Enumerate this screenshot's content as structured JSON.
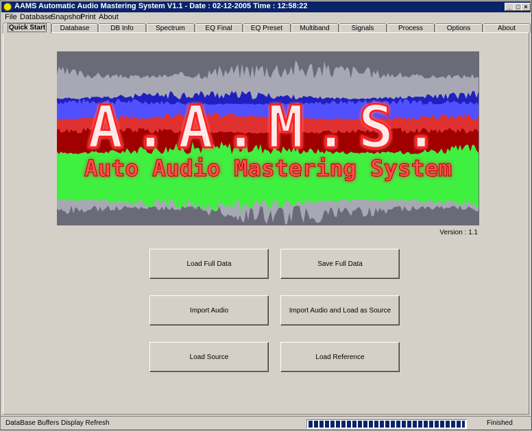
{
  "window": {
    "title": "AAMS Automatic Audio Mastering System V1.1  -  Date :  02-12-2005   Time : 12:58:22"
  },
  "menu": [
    "File",
    "Database",
    "Snapshot",
    "Print",
    "About"
  ],
  "tabs": [
    "Quick Start",
    "Database",
    "DB Info",
    "Spectrum",
    "EQ Final",
    "EQ Preset",
    "Multiband",
    "Signals",
    "Process",
    "Options",
    "About"
  ],
  "active_tab": "Quick Start",
  "banner": {
    "logo_text": "A.A.M.S.",
    "logo_subtitle": "Auto Audio Mastering System"
  },
  "version": "Version : 1.1",
  "buttons": {
    "load_full_data": "Load Full Data",
    "save_full_data": "Save Full Data",
    "import_audio": "Import Audio",
    "import_audio_load_source": "Import Audio and Load as Source",
    "load_source": "Load Source",
    "load_reference": "Load Reference"
  },
  "status": {
    "left": "DataBase Buffers Display Refresh",
    "right": "Finished",
    "progress": 1.0
  },
  "colors": {
    "titlebar": "#0a246a",
    "face": "#d4d0c8",
    "wave_gray": "#a8a8b4",
    "wave_blue": "#5050ff",
    "wave_red": "#e03030",
    "wave_green": "#40f040",
    "logo_red": "#ff3030"
  }
}
